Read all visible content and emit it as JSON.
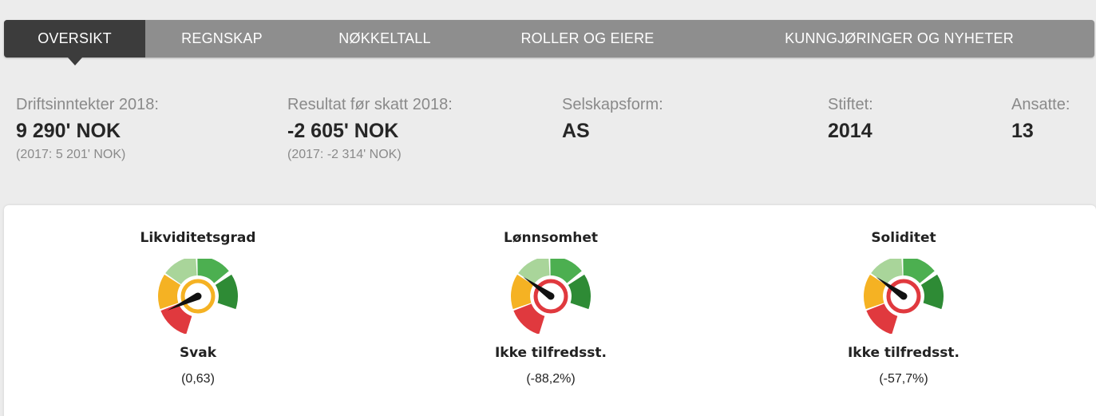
{
  "tabs": [
    {
      "label": "OVERSIKT",
      "active": true
    },
    {
      "label": "REGNSKAP",
      "active": false
    },
    {
      "label": "NØKKELTALL",
      "active": false
    },
    {
      "label": "ROLLER OG EIERE",
      "active": false
    },
    {
      "label": "KUNNGJØRINGER OG NYHETER",
      "active": false
    }
  ],
  "facts": {
    "revenue": {
      "label": "Driftsinntekter 2018:",
      "value": "9 290' NOK",
      "sub": "(2017: 5 201' NOK)"
    },
    "result": {
      "label": "Resultat før skatt 2018:",
      "value": "-2 605' NOK",
      "sub": "(2017: -2 314' NOK)"
    },
    "company_form": {
      "label": "Selskapsform:",
      "value": "AS"
    },
    "founded": {
      "label": "Stiftet:",
      "value": "2014"
    },
    "employees": {
      "label": "Ansatte:",
      "value": "13"
    }
  },
  "metrics": [
    {
      "title": "Likviditetsgrad",
      "status": "Svak",
      "detail": "(0,63)",
      "ring_color": "#f5b223",
      "needle_angle_deg": 205
    },
    {
      "title": "Lønnsomhet",
      "status": "Ikke tilfredsst.",
      "detail": "(-88,2%)",
      "ring_color": "#e0393e",
      "needle_angle_deg": 145
    },
    {
      "title": "Soliditet",
      "status": "Ikke tilfredsst.",
      "detail": "(-57,7%)",
      "ring_color": "#e0393e",
      "needle_angle_deg": 145
    }
  ],
  "gauge_colors": [
    "#e0393e",
    "#f5b223",
    "#a9d59a",
    "#4caf50",
    "#2e8b35"
  ]
}
